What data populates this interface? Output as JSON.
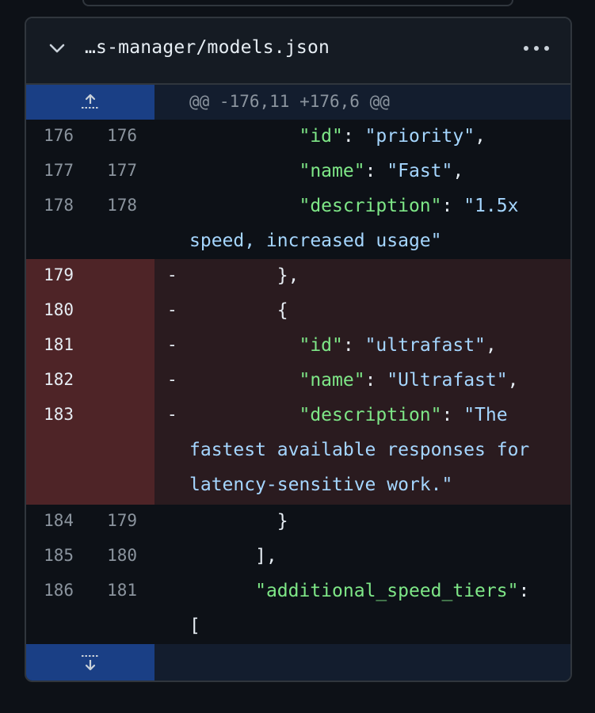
{
  "file": {
    "name": "…s-manager/models.json"
  },
  "hunk": {
    "header": "@@ -176,11 +176,6 @@"
  },
  "lines": [
    {
      "old": "176",
      "new": "176",
      "type": "context",
      "text": "          \"id\": \"priority\","
    },
    {
      "old": "177",
      "new": "177",
      "type": "context",
      "text": "          \"name\": \"Fast\","
    },
    {
      "old": "178",
      "new": "178",
      "type": "context",
      "text": "          \"description\": \"1.5x",
      "wrap": "speed, increased usage\""
    },
    {
      "old": "179",
      "new": "",
      "type": "del",
      "sign": "-",
      "text": "        },"
    },
    {
      "old": "180",
      "new": "",
      "type": "del",
      "sign": "-",
      "text": "        {"
    },
    {
      "old": "181",
      "new": "",
      "type": "del",
      "sign": "-",
      "text": "          \"id\": \"ultrafast\","
    },
    {
      "old": "182",
      "new": "",
      "type": "del",
      "sign": "-",
      "text": "          \"name\": \"Ultrafast\","
    },
    {
      "old": "183",
      "new": "",
      "type": "del",
      "sign": "-",
      "text": "          \"description\": \"The",
      "wrap": "fastest available responses for",
      "wrap2": "latency-sensitive work.\""
    },
    {
      "old": "184",
      "new": "179",
      "type": "context",
      "text": "        }"
    },
    {
      "old": "185",
      "new": "180",
      "type": "context",
      "text": "      ],"
    },
    {
      "old": "186",
      "new": "181",
      "type": "context",
      "text": "      \"additional_speed_tiers\":",
      "wrap": "["
    }
  ],
  "icons": {
    "chevron": "chevron-down-icon",
    "more": "kebab-horizontal-icon",
    "expand_up": "unfold-up-icon",
    "expand_down": "unfold-down-icon"
  },
  "colors": {
    "background": "#0d1117",
    "header_bg": "#151b23",
    "hunk_gutter": "#1a3f85",
    "del_gutter": "#4e2427",
    "del_code": "#2a1b1f",
    "json_key": "#7ee787",
    "json_string": "#a5d6ff"
  }
}
